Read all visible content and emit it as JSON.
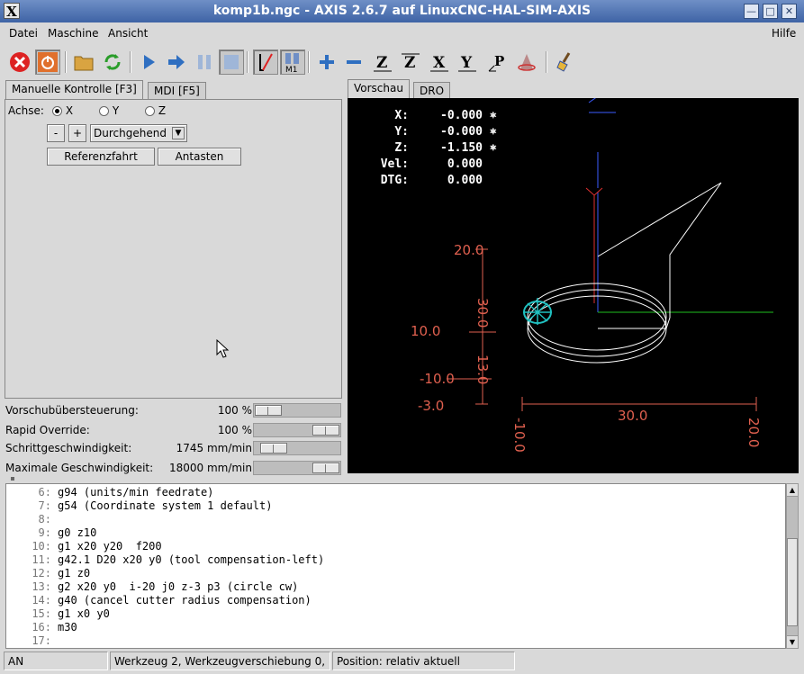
{
  "window": {
    "title": "komp1b.ngc - AXIS 2.6.7 auf  LinuxCNC-HAL-SIM-AXIS",
    "logo": "X"
  },
  "menu": {
    "datei": "Datei",
    "maschine": "Maschine",
    "ansicht": "Ansicht",
    "hilfe": "Hilfe"
  },
  "toolbar": {
    "mode_label": "M1"
  },
  "left_tabs": {
    "manual": "Manuelle Kontrolle [F3]",
    "mdi": "MDI [F5]"
  },
  "manual": {
    "axis_label": "Achse:",
    "axes": [
      "X",
      "Y",
      "Z"
    ],
    "selected_axis": "X",
    "minus": "-",
    "plus": "+",
    "jog_mode": "Durchgehend",
    "home_button": "Referenzfahrt",
    "touch_button": "Antasten"
  },
  "overrides": [
    {
      "label": "Vorschubübersteuerung:",
      "value": "100 %",
      "fraction": 0.0
    },
    {
      "label": "Rapid Override:",
      "value": "100 %",
      "fraction": 1.0
    },
    {
      "label": "Schrittgeschwindigkeit:",
      "value": "1745 mm/min",
      "fraction": 0.1
    },
    {
      "label": "Maximale Geschwindigkeit:",
      "value": "18000 mm/min",
      "fraction": 1.0
    }
  ],
  "right_tabs": {
    "preview": "Vorschau",
    "dro": "DRO"
  },
  "dro": [
    {
      "label": "X:",
      "value": "-0.000"
    },
    {
      "label": "Y:",
      "value": "-0.000"
    },
    {
      "label": "Z:",
      "value": "-1.150"
    },
    {
      "label": "Vel:",
      "value": "0.000"
    },
    {
      "label": "DTG:",
      "value": "0.000"
    }
  ],
  "preview_dims": {
    "y_top": "20.0",
    "y_len": "30.0",
    "y_mid": "10.0",
    "y_neg": "-10.0",
    "z_len": "13.0",
    "z_neg": "-3.0",
    "x_len": "30.0",
    "x_min": "-10.0",
    "x_max": "20.0"
  },
  "program": [
    {
      "num": "6:",
      "text": "g94 (units/min feedrate)"
    },
    {
      "num": "7:",
      "text": "g54 (Coordinate system 1 default)"
    },
    {
      "num": "8:",
      "text": ""
    },
    {
      "num": "9:",
      "text": "g0 z10"
    },
    {
      "num": "10:",
      "text": "g1 x20 y20  f200"
    },
    {
      "num": "11:",
      "text": "g42.1 D20 x20 y0 (tool compensation-left)"
    },
    {
      "num": "12:",
      "text": "g1 z0"
    },
    {
      "num": "13:",
      "text": "g2 x20 y0  i-20 j0 z-3 p3 (circle cw)"
    },
    {
      "num": "14:",
      "text": "g40 (cancel cutter radius compensation)"
    },
    {
      "num": "15:",
      "text": "g1 x0 y0"
    },
    {
      "num": "16:",
      "text": "m30"
    },
    {
      "num": "17:",
      "text": ""
    }
  ],
  "status": {
    "state": "AN",
    "tool": "Werkzeug 2, Werkzeugverschiebung 0,",
    "position": "Position: relativ aktuell"
  },
  "colors": {
    "titlebar": "#3e63a5",
    "dim": "#e0604f",
    "toolpath": "#ffffff",
    "background": "#000000"
  }
}
